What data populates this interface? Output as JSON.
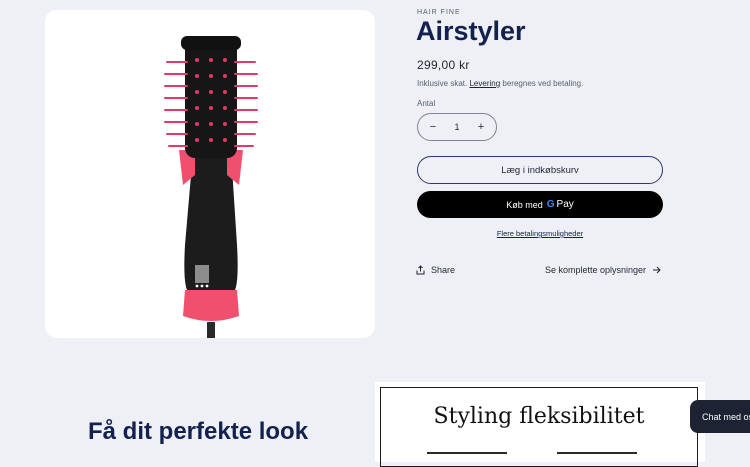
{
  "product": {
    "vendor": "HAIR FINE",
    "title": "Airstyler",
    "price": "299,00 kr",
    "tax_note_prefix": "Inklusive skat.",
    "tax_note_link": "Levering",
    "tax_note_suffix": "beregnes ved betaling.",
    "image_alt": "Airstyler hot air brush"
  },
  "quantity": {
    "label": "Antal",
    "value": "1",
    "decrease_symbol": "−",
    "increase_symbol": "+"
  },
  "actions": {
    "add_to_cart": "Læg i indkøbskurv",
    "buy_prefix": "Køb med",
    "gpay_g": "G",
    "gpay_pay": "Pay",
    "more_payment_options": "Flere betalingsmuligheder",
    "share": "Share",
    "full_details": "Se komplette oplysninger"
  },
  "sections": {
    "heading": "Få dit perfekte look",
    "promo_title": "Styling fleksibilitet"
  },
  "chat": {
    "label": "Chat med os"
  },
  "colors": {
    "page_bg": "#eef0f6",
    "title": "#13214f",
    "brush_body": "#1a1a1a",
    "brush_accent": "#f0506e"
  }
}
